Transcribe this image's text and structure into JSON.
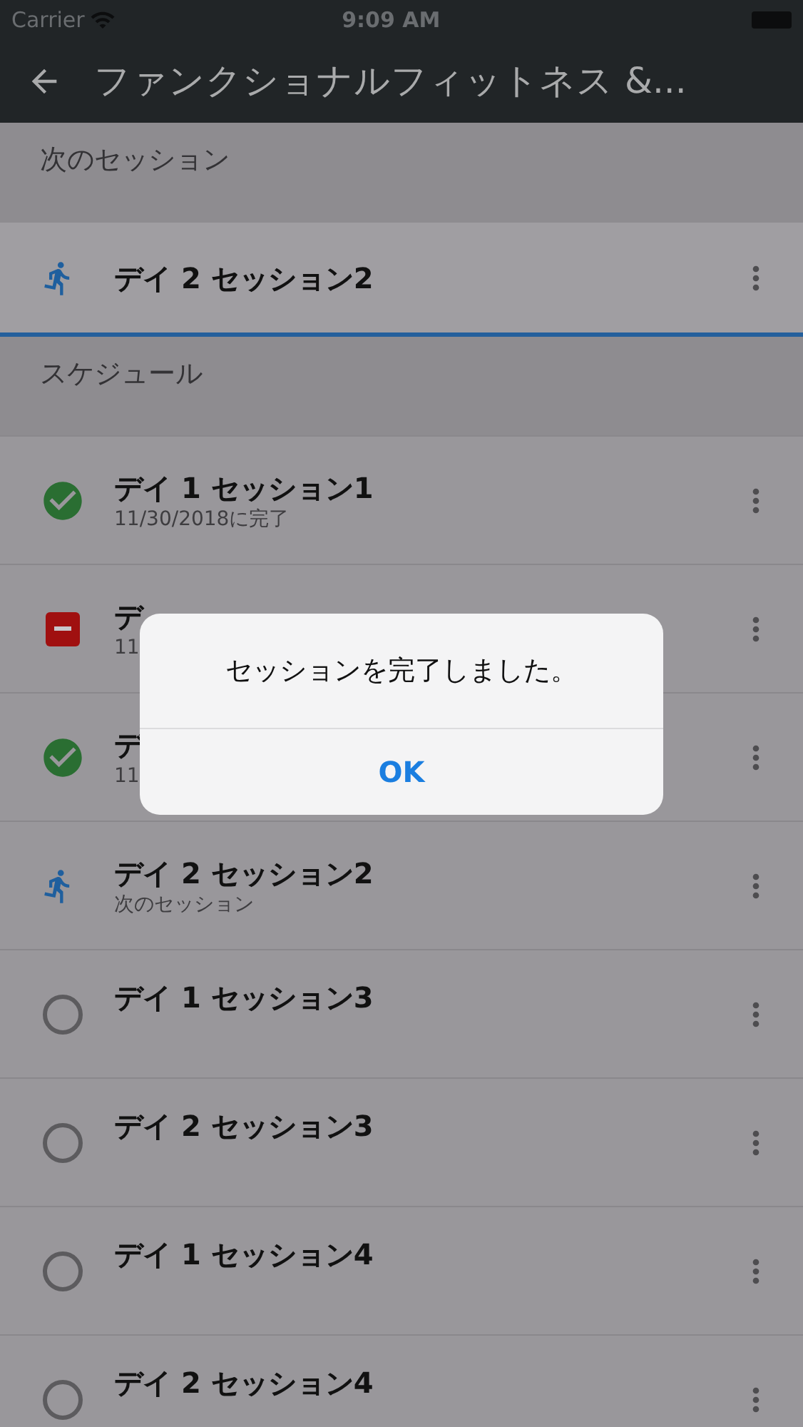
{
  "status_bar": {
    "carrier": "Carrier",
    "time": "9:09 AM"
  },
  "header": {
    "title": "ファンクショナルフィットネス &..."
  },
  "next_section": {
    "heading": "次のセッション",
    "item": {
      "kind": "next",
      "title": "デイ 2 セッション2",
      "selected": true
    }
  },
  "schedule": {
    "heading": "スケジュール",
    "items": [
      {
        "kind": "done",
        "title": "デイ 1 セッション1",
        "subtitle": "11/30/2018に完了"
      },
      {
        "kind": "skipped",
        "title": "デ",
        "subtitle": "11"
      },
      {
        "kind": "done",
        "title": "デ",
        "subtitle": "11"
      },
      {
        "kind": "next",
        "title": "デイ 2 セッション2",
        "subtitle": "次のセッション"
      },
      {
        "kind": "pending",
        "title": "デイ 1 セッション3"
      },
      {
        "kind": "pending",
        "title": "デイ 2 セッション3"
      },
      {
        "kind": "pending",
        "title": "デイ 1 セッション4"
      },
      {
        "kind": "pending",
        "title": "デイ 2 セッション4"
      }
    ]
  },
  "dialog": {
    "message": "セッションを完了しました。",
    "button": "OK"
  }
}
